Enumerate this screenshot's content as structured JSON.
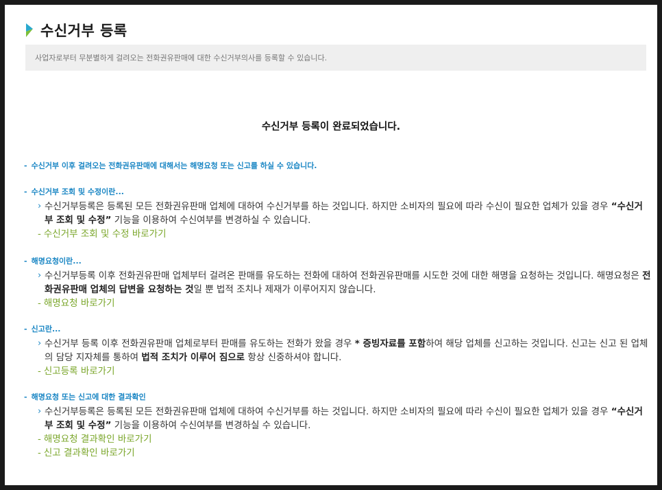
{
  "header": {
    "title": "수신거부 등록",
    "description": "사업자로부터 무분별하게 걸려오는 전화권유판매에 대한 수신거부의사를 등록할 수 있습니다."
  },
  "completion_message": "수신거부 등록이 완료되었습니다.",
  "notice": "수신거부 이후 걸려오는 전화권유판매에 대해서는 해명요청 또는 신고를 하실 수 있습니다.",
  "sections": [
    {
      "heading": "수신거부 조회 및 수정이란...",
      "text_a": "수신거부등록은 등록된 모든 전화권유판매 업체에 대하여 수신거부를 하는 것입니다. 하지만 소비자의 필요에 따라 수신이 필요한 업체가 있을 경우 ",
      "text_b": "“수신거부 조회 및 수정”",
      "text_c": " 기능을 이용하여 수신여부를 변경하실 수 있습니다.",
      "links": [
        "수신거부 조회 및 수정 바로가기"
      ]
    },
    {
      "heading": "해명요청이란...",
      "text_a": "수신거부등록 이후 전화권유판매 업체부터 걸려온 판매를 유도하는 전화에 대하여 전화권유판매를 시도한 것에 대한 해명을 요청하는 것입니다. 해명요청은 ",
      "text_b": "전화권유판매 업체의 답변을 요청하는 것",
      "text_c": "일 뿐 법적 조치나 제재가 이루어지지 않습니다.",
      "links": [
        "해명요청 바로가기"
      ]
    },
    {
      "heading": "신고란...",
      "text_a": "수신거부 등록 이후 전화권유판매 업체로부터 판매를 유도하는 전화가 왔을 경우 ",
      "text_b": " * 증빙자료를 포함",
      "text_c": "하여 해당 업체를 신고하는 것입니다. 신고는 신고 된 업체의 담당 지자체를 통하여 ",
      "text_d": "법적 조치가 이루어 짐으로",
      "text_e": " 항상 신중하셔야 합니다.",
      "links": [
        "신고등록 바로가기"
      ]
    },
    {
      "heading": "해명요청 또는 신고에 대한 결과확인",
      "text_a": "수신거부등록은 등록된 모든 전화권유판매 업체에 대하여 수신거부를 하는 것입니다. 하지만 소비자의 필요에 따라 수신이 필요한 업체가 있을 경우 ",
      "text_b": "“수신거부 조회 및 수정”",
      "text_c": " 기능을 이용하여 수신여부를 변경하실 수 있습니다.",
      "links": [
        "해명요청 결과확인 바로가기",
        "신고 결과확인 바로가기"
      ]
    }
  ],
  "colors": {
    "accent_blue": "#1a86c4",
    "accent_green": "#7aa62a",
    "desc_bg": "#efefef"
  },
  "icons": {
    "title_mark": "title-marker-icon",
    "bullet": "chevron-right-icon"
  }
}
